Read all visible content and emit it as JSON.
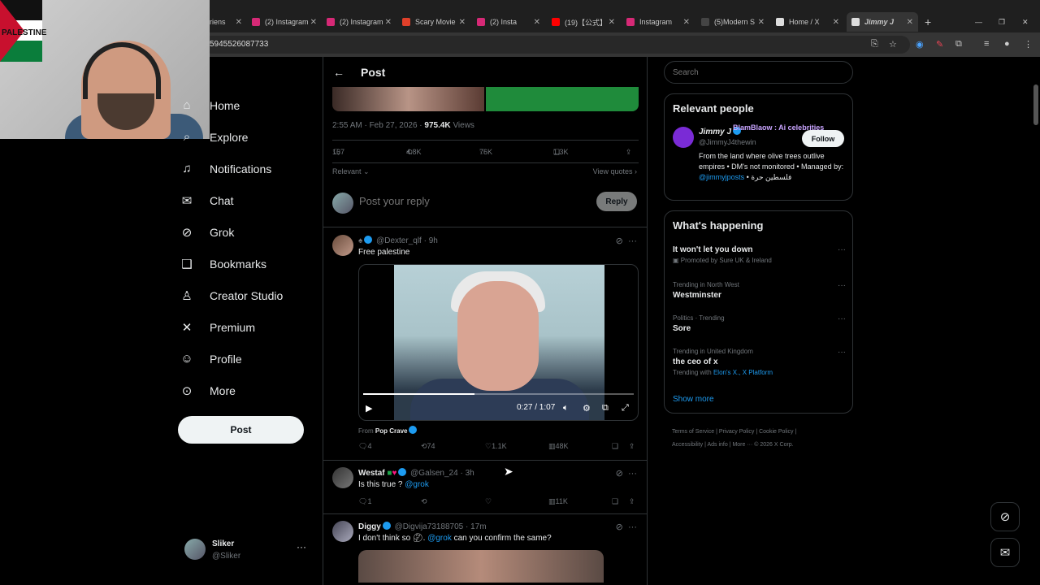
{
  "browser": {
    "tabs": [
      {
        "label": "riens",
        "fav_color": "#888"
      },
      {
        "label": "(2) Instagram",
        "fav_color": "#d62976"
      },
      {
        "label": "(2) Instagram",
        "fav_color": "#d62976"
      },
      {
        "label": "Scary Movie",
        "fav_color": "#e0402a"
      },
      {
        "label": "(2) Insta",
        "fav_color": "#d62976"
      },
      {
        "label": "(19)【公式】",
        "fav_color": "#ff0000"
      },
      {
        "label": "Instagram",
        "fav_color": "#d62976"
      },
      {
        "label": "(5)Modern S",
        "fav_color": "#111"
      },
      {
        "label": "Home / X",
        "fav_color": "#fff"
      },
      {
        "label": "Jimmy J",
        "fav_color": "#fff"
      }
    ],
    "url": "5945526087733"
  },
  "webcam": {
    "flag_text": "PALESTINE"
  },
  "nav": {
    "items": [
      {
        "label": "Home",
        "icon": "home-icon",
        "glyph": "⌂"
      },
      {
        "label": "Explore",
        "icon": "search-icon",
        "glyph": "⌕"
      },
      {
        "label": "Notifications",
        "icon": "bell-icon",
        "glyph": "♫"
      },
      {
        "label": "Chat",
        "icon": "mail-icon",
        "glyph": "✉"
      },
      {
        "label": "Grok",
        "icon": "grok-icon",
        "glyph": "⊘"
      },
      {
        "label": "Bookmarks",
        "icon": "bookmark-icon",
        "glyph": "❑"
      },
      {
        "label": "Creator Studio",
        "icon": "flask-icon",
        "glyph": "♙"
      },
      {
        "label": "Premium",
        "icon": "x-logo-icon",
        "glyph": "✕"
      },
      {
        "label": "Profile",
        "icon": "person-icon",
        "glyph": "☺"
      },
      {
        "label": "More",
        "icon": "more-circle-icon",
        "glyph": "⊙"
      }
    ],
    "post_label": "Post"
  },
  "account": {
    "name": "Sliker",
    "handle": "@Sliker"
  },
  "main": {
    "title": "Post",
    "post_meta_time": "2:55 AM · Feb 27, 2026 ·",
    "post_meta_views": "975.4K",
    "post_meta_views_label": "Views",
    "stats": {
      "replies": "167",
      "reposts": "4.8K",
      "likes": "76K",
      "bookmarks": "1.3K"
    },
    "relevant_label": "Relevant",
    "view_quotes": "View quotes",
    "reply_placeholder": "Post your reply",
    "reply_button": "Reply"
  },
  "replies": [
    {
      "name": "",
      "handle": "@Dexter_qlf · 9h",
      "text": "Free palestine",
      "video_time": "0:27 / 1:07",
      "video_progress": 0.41,
      "from_label": "From",
      "from_source": "Pop Crave",
      "replies": "4",
      "reposts": "74",
      "likes": "1.1K",
      "views": "48K"
    },
    {
      "name": "Westaf",
      "handle": "@Galsen_24 · 3h",
      "text": "Is this true ?",
      "mention": "@grok",
      "replies": "1",
      "reposts": "",
      "likes": "",
      "views": "11K"
    },
    {
      "name": "Diggy",
      "handle": "@Digvija73188705 · 17m",
      "text_a": "I don't think so",
      "mention": "@grok",
      "text_b": "can you confirm the same?"
    }
  ],
  "right": {
    "search_placeholder": "Search",
    "relevant_title": "Relevant people",
    "person_name": "Jimmy J",
    "person_overlay": "BlamBlaow : Ai celebrities",
    "person_handle": "@JimmyJ4thewin",
    "follow_label": "Follow",
    "bio_a": "From the land where olive trees outlive empires • DM's not monitored • Managed by:",
    "bio_link": "@jimmyjposts",
    "bio_b": "• فلسطين حرة",
    "happening_title": "What's happening",
    "trends": [
      {
        "sub": "",
        "title": "It won't let you down",
        "extra": "Promoted by Sure UK & Ireland"
      },
      {
        "sub": "Trending in North West",
        "title": "Westminster",
        "extra": ""
      },
      {
        "sub": "Politics · Trending",
        "title": "Sore",
        "extra": ""
      },
      {
        "sub": "Trending in United Kingdom",
        "title": "the ceo of x",
        "extra": "Trending with"
      }
    ],
    "trend_links": "Elon's X., X Platform",
    "show_more": "Show more",
    "footer_a": "Terms of Service  |  Privacy Policy  |  Cookie Policy  |",
    "footer_b": "Accessibility  |  Ads info  |  More ···  © 2026 X Corp."
  }
}
